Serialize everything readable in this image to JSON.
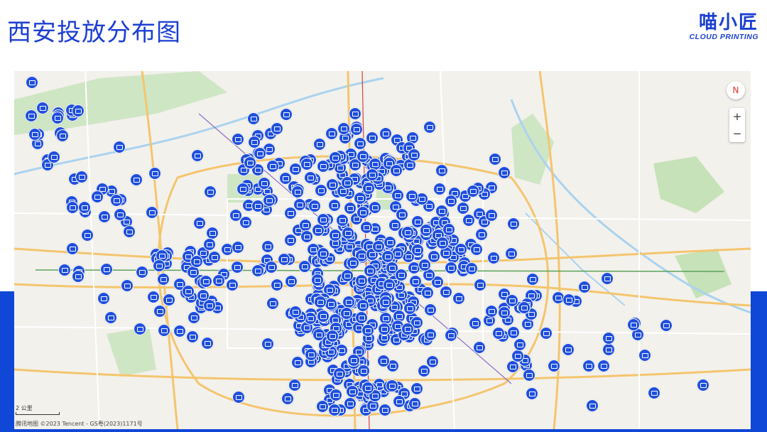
{
  "title": "西安投放分布图",
  "logo": {
    "cn": "喵小匠",
    "en": "CLOUD PRINTING"
  },
  "map": {
    "zoom_in": "+",
    "zoom_out": "−",
    "compass": "N",
    "scale_label": "2 公里",
    "attribution": "腾讯地图 ©2023 Tencent - GS粤(2023)1171号"
  },
  "colors": {
    "brand": "#1b3fd1",
    "band": "#0f47d6",
    "pin": "#1f4fdc"
  },
  "icons": {
    "pin": "printer-location-icon"
  }
}
